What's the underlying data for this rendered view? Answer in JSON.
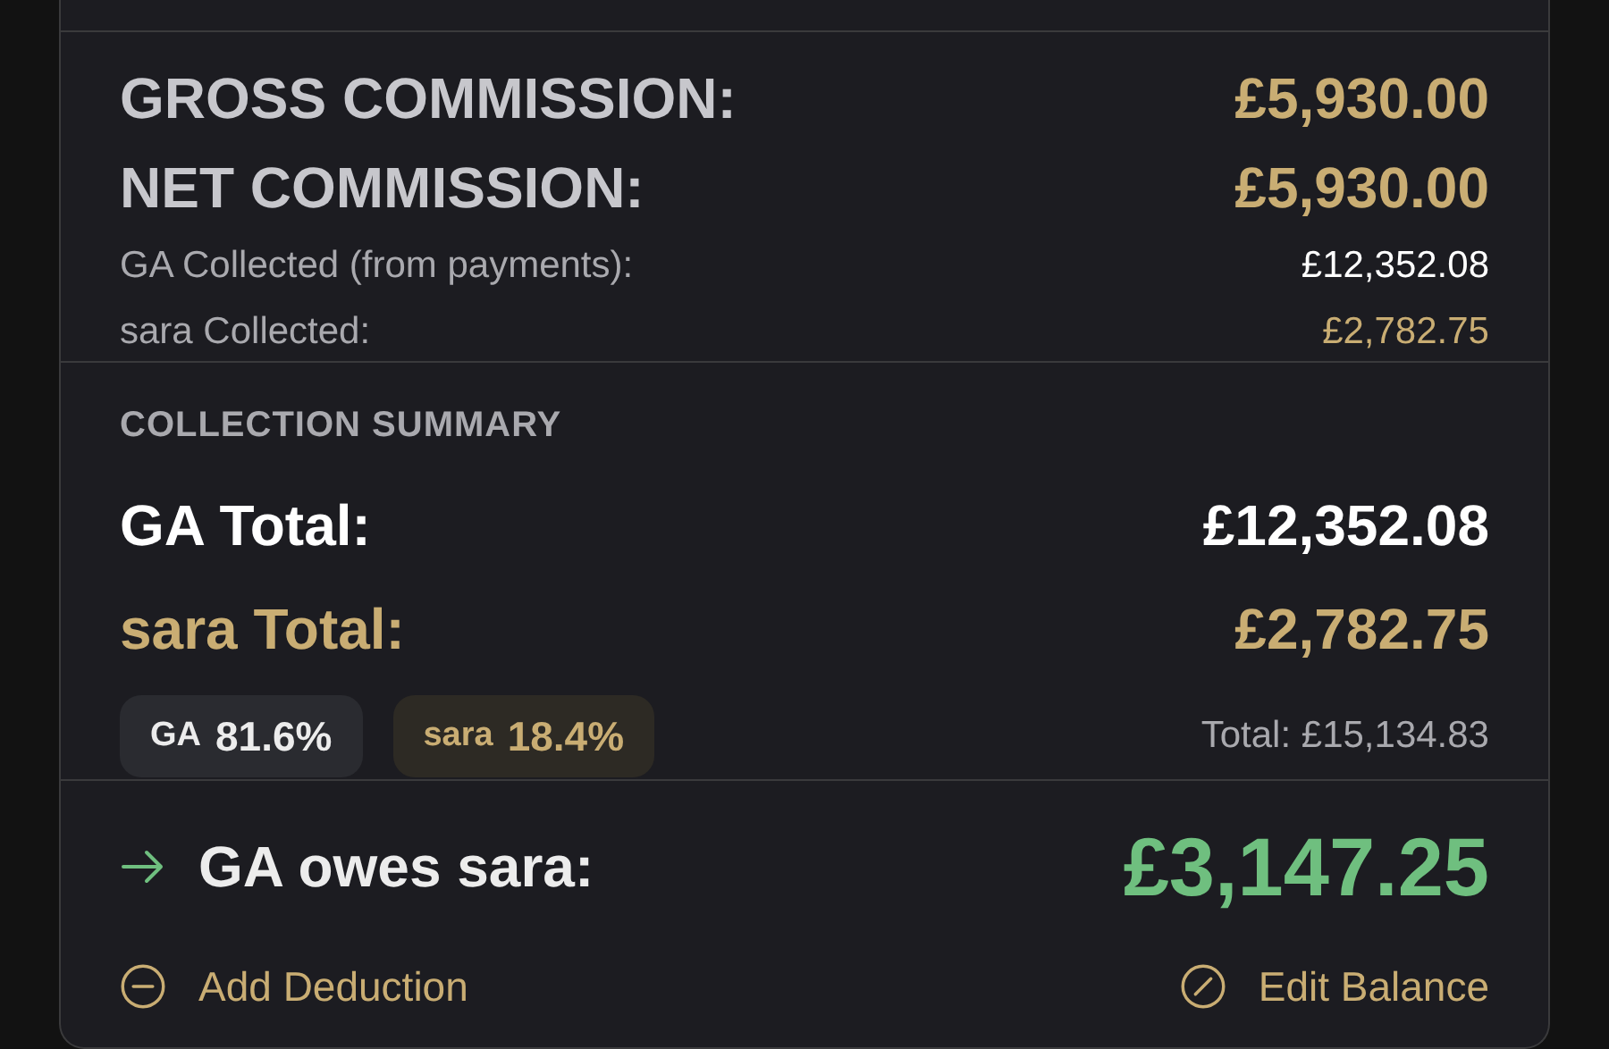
{
  "commission": {
    "rows": [
      {
        "kind": "big",
        "label": "GROSS COMMISSION:",
        "value": "£5,930.00"
      },
      {
        "kind": "big",
        "label": "NET COMMISSION:",
        "value": "£5,930.00"
      },
      {
        "kind": "small",
        "label": "GA Collected (from payments):",
        "value": "£12,352.08",
        "highlight": false
      },
      {
        "kind": "small",
        "label": "sara Collected:",
        "value": "£2,782.75",
        "highlight": true
      }
    ]
  },
  "collection_summary": {
    "heading": "COLLECTION SUMMARY",
    "totals": [
      {
        "label": "GA Total:",
        "value": "£12,352.08",
        "highlight": false
      },
      {
        "label": "sara Total:",
        "value": "£2,782.75",
        "highlight": true
      }
    ],
    "shares": [
      {
        "name": "GA",
        "percent": "81.6%",
        "highlight": false
      },
      {
        "name": "sara",
        "percent": "18.4%",
        "highlight": true
      }
    ],
    "grand_total": "Total: £15,134.83"
  },
  "balance": {
    "label": "GA owes sara:",
    "amount": "£3,147.25"
  },
  "actions": [
    {
      "kind": "deduction",
      "label": "Add Deduction"
    },
    {
      "kind": "edit",
      "label": "Edit Balance"
    }
  ]
}
